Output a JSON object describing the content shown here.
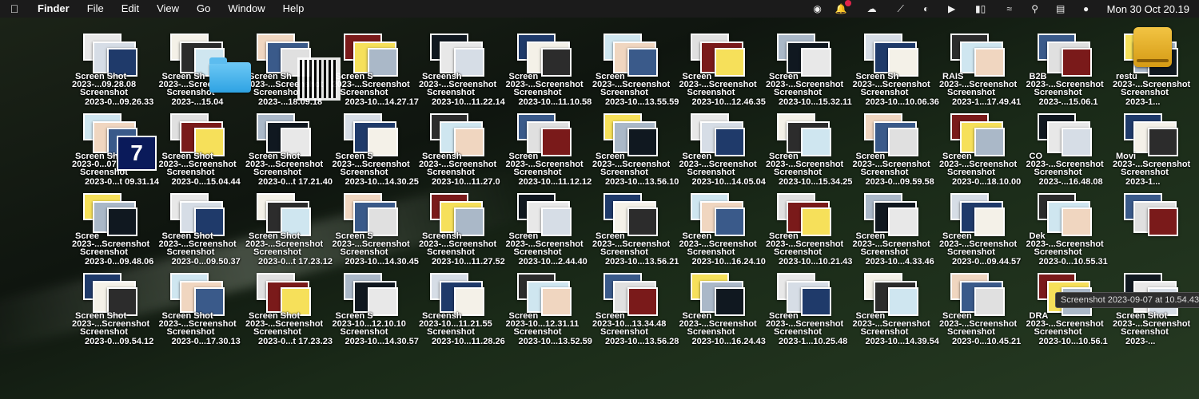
{
  "menubar": {
    "apple": "",
    "app_name": "Finder",
    "menus": [
      "File",
      "Edit",
      "View",
      "Go",
      "Window",
      "Help"
    ],
    "status_icons": [
      "creative-cloud-icon",
      "notification-bell-icon",
      "cloud-icon",
      "slash-icon",
      "media-icon",
      "play-icon",
      "battery-icon",
      "wifi-icon",
      "search-icon",
      "control-center-icon",
      "siri-icon"
    ],
    "clock": "Mon 30 Oct  20.19"
  },
  "desktop": {
    "tooltip": "Screenshot 2023-09-07 at 10.54.43",
    "rows": [
      [
        {
          "l1": "Screen Shot",
          "l2": "2023-...09.28.08",
          "l3": "Screenshot",
          "l4": "2023-0...09.26.33"
        },
        {
          "l1": "Screen Sh",
          "l2": "2023-...Screenshot",
          "l3": "Screenshot",
          "l4": "2023-...15.04"
        },
        {
          "l1": "Screen Sh",
          "l2": "2023-...Screenshot",
          "l3": "Screenshot",
          "l4": "2023-...18.09.18"
        },
        {
          "l1": "Screen S",
          "l2": "2023-...Screenshot",
          "l3": "Screenshot",
          "l4": "2023-10...14.27.17"
        },
        {
          "l1": "Screensh",
          "l2": "2023-...Screenshot",
          "l3": "Screenshot",
          "l4": "2023-10...11.22.14"
        },
        {
          "l1": "Screen",
          "l2": "2023-...Screenshot",
          "l3": "Screenshot",
          "l4": "2023-10...11.10.58"
        },
        {
          "l1": "Screen",
          "l2": "2023-...Screenshot",
          "l3": "Screenshot",
          "l4": "2023-10...13.55.59"
        },
        {
          "l1": "Screen",
          "l2": "2023-...Screenshot",
          "l3": "Screenshot",
          "l4": "2023-10...12.46.35"
        },
        {
          "l1": "Screen",
          "l2": "2023-...Screenshot",
          "l3": "Screenshot",
          "l4": "2023-10...15.32.11"
        },
        {
          "l1": "Screen Sh",
          "l2": "2023-...Screenshot",
          "l3": "Screenshot",
          "l4": "2023-10...10.06.36"
        },
        {
          "l1": "RAIS",
          "l2": "2023-...Screenshot",
          "l3": "Screenshot",
          "l4": "2023-1...17.49.41"
        },
        {
          "l1": "B2B",
          "l2": "2023-...Screenshot",
          "l3": "Screenshot",
          "l4": "2023-...15.06.1"
        },
        {
          "l1": "restu",
          "l2": "2023-...Screenshot",
          "l3": "Screenshot",
          "l4": "2023-1..."
        }
      ],
      [
        {
          "l1": "Screen Shot",
          "l2": "2023-0...07.32",
          "l3": "Screenshot",
          "l4": "2023-0...t 09.31.14"
        },
        {
          "l1": "Screen Shot",
          "l2": "2023-...Screenshot",
          "l3": "Screenshot",
          "l4": "2023-0...15.04.44"
        },
        {
          "l1": "Screen Shot",
          "l2": "2023-...Screenshot",
          "l3": "Screenshot",
          "l4": "2023-0...t 17.21.40"
        },
        {
          "l1": "Screen S",
          "l2": "2023-...Screenshot",
          "l3": "Screenshot",
          "l4": "2023-10...14.30.25"
        },
        {
          "l1": "Screensh",
          "l2": "2023-...Screenshot",
          "l3": "Screenshot",
          "l4": "2023-10...11.27.0"
        },
        {
          "l1": "Screen",
          "l2": "2023-...Screenshot",
          "l3": "Screenshot",
          "l4": "2023-10...11.12.12"
        },
        {
          "l1": "Screen",
          "l2": "2023-...Screenshot",
          "l3": "Screenshot",
          "l4": "2023-10...13.56.10"
        },
        {
          "l1": "Screen",
          "l2": "2023-...Screenshot",
          "l3": "Screenshot",
          "l4": "2023-10...14.05.04"
        },
        {
          "l1": "Screen",
          "l2": "2023-...Screenshot",
          "l3": "Screenshot",
          "l4": "2023-10...15.34.25"
        },
        {
          "l1": "Screen",
          "l2": "2023-...Screenshot",
          "l3": "Screenshot",
          "l4": "2023-0...09.59.58"
        },
        {
          "l1": "Screen",
          "l2": "2023-...Screenshot",
          "l3": "Screenshot",
          "l4": "2023-0...18.10.00"
        },
        {
          "l1": "CO",
          "l2": "2023-...Screenshot",
          "l3": "Screenshot",
          "l4": "2023-...16.48.08"
        },
        {
          "l1": "Movi",
          "l2": "2023-...Screenshot",
          "l3": "Screenshot",
          "l4": "2023-1..."
        }
      ],
      [
        {
          "l1": "Scree",
          "l2": "2023-...Screenshot",
          "l3": "Screenshot",
          "l4": "2023-0...09.48.06"
        },
        {
          "l1": "Screen Shot",
          "l2": "2023-...Screenshot",
          "l3": "Screenshot",
          "l4": "2023-0...09.50.37"
        },
        {
          "l1": "Screen Shot",
          "l2": "2023-...Screenshot",
          "l3": "Screenshot",
          "l4": "2023-0...t 17.23.12"
        },
        {
          "l1": "Screen S",
          "l2": "2023-...Screenshot",
          "l3": "Screenshot",
          "l4": "2023-10...14.30.45"
        },
        {
          "l1": "Screensh",
          "l2": "2023-...Screenshot",
          "l3": "Screenshot",
          "l4": "2023-10...11.27.52"
        },
        {
          "l1": "Screen",
          "l2": "2023-...Screenshot",
          "l3": "Screenshot",
          "l4": "2023-10...2.44.40"
        },
        {
          "l1": "Screen",
          "l2": "2023-...Screenshot",
          "l3": "Screenshot",
          "l4": "2023-10...13.56.21"
        },
        {
          "l1": "Screen",
          "l2": "2023-...Screenshot",
          "l3": "Screenshot",
          "l4": "2023-10...16.24.10"
        },
        {
          "l1": "Screen",
          "l2": "2023-...Screenshot",
          "l3": "Screenshot",
          "l4": "2023-10...10.21.43"
        },
        {
          "l1": "Screen",
          "l2": "2023-...Screenshot",
          "l3": "Screenshot",
          "l4": "2023-10...4.33.46"
        },
        {
          "l1": "Screen",
          "l2": "2023-...Screenshot",
          "l3": "Screenshot",
          "l4": "2023-0...09.44.57"
        },
        {
          "l1": "Dek",
          "l2": "2023-...Screenshot",
          "l3": "Screenshot",
          "l4": "2023-0...10.55.31"
        },
        {
          "l1": "",
          "l2": "",
          "l3": "",
          "l4": ""
        }
      ],
      [
        {
          "l1": "Screen Shot",
          "l2": "2023-...Screenshot",
          "l3": "Screenshot",
          "l4": "2023-0...09.54.12"
        },
        {
          "l1": "Screen Shot",
          "l2": "2023-...Screenshot",
          "l3": "Screenshot",
          "l4": "2023-0...17.30.13"
        },
        {
          "l1": "Screen Shot",
          "l2": "2023-...Screenshot",
          "l3": "Screenshot",
          "l4": "2023-0...t 17.23.23"
        },
        {
          "l1": "Screen S",
          "l2": "2023-10...12.10.10",
          "l3": "Screenshot",
          "l4": "2023-10...14.30.57"
        },
        {
          "l1": "Screensh",
          "l2": "2023-10...11.21.55",
          "l3": "Screenshot",
          "l4": "2023-10...11.28.26"
        },
        {
          "l1": "Screen",
          "l2": "2023-10...12.31.11",
          "l3": "Screenshot",
          "l4": "2023-10...13.52.59"
        },
        {
          "l1": "Screen",
          "l2": "2023-10...13.34.48",
          "l3": "Screenshot",
          "l4": "2023-10...13.56.28"
        },
        {
          "l1": "Screen",
          "l2": "2023-...Screenshot",
          "l3": "Screenshot",
          "l4": "2023-10...16.24.43"
        },
        {
          "l1": "Screen",
          "l2": "2023-...Screenshot",
          "l3": "Screenshot",
          "l4": "2023-1...10.25.48"
        },
        {
          "l1": "Screen",
          "l2": "2023-...Screenshot",
          "l3": "Screenshot",
          "l4": "2023-10...14.39.54"
        },
        {
          "l1": "Screen",
          "l2": "2023-...Screenshot",
          "l3": "Screenshot",
          "l4": "2023-0...10.45.21"
        },
        {
          "l1": "DRA",
          "l2": "2023-...Screenshot",
          "l3": "Screenshot",
          "l4": "2023-10...10.56.1"
        },
        {
          "l1": "Screen Shot",
          "l2": "2023-...Screenshot",
          "l3": "Screenshot",
          "l4": "2023-..."
        }
      ]
    ]
  }
}
